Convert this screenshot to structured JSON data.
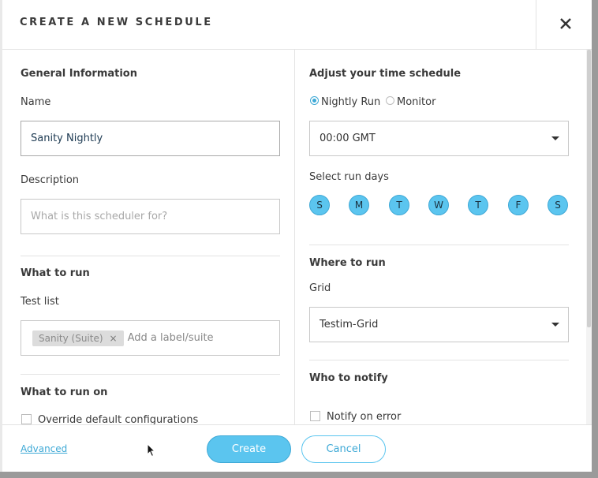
{
  "modal": {
    "title": "CREATE A NEW SCHEDULE"
  },
  "left": {
    "general_heading": "General Information",
    "name_label": "Name",
    "name_value": "Sanity Nightly",
    "description_label": "Description",
    "description_placeholder": "What is this scheduler for?",
    "what_to_run_heading": "What to run",
    "test_list_label": "Test list",
    "test_list_tags": [
      {
        "label": "Sanity (Suite)",
        "remove": "×"
      }
    ],
    "test_list_placeholder": "Add a label/suite",
    "what_to_run_on_heading": "What to run on",
    "override_label": "Override default configurations"
  },
  "right": {
    "time_heading": "Adjust your time schedule",
    "modes": [
      {
        "label": "Nightly Run",
        "checked": true
      },
      {
        "label": "Monitor",
        "checked": false
      }
    ],
    "time_value": "00:00 GMT",
    "run_days_label": "Select run days",
    "days": [
      "S",
      "M",
      "T",
      "W",
      "T",
      "F",
      "S"
    ],
    "where_heading": "Where to run",
    "grid_label": "Grid",
    "grid_value": "Testim-Grid",
    "notify_heading": "Who to notify",
    "notify_on_error_label": "Notify on error"
  },
  "footer": {
    "advanced_label": "Advanced",
    "create_label": "Create",
    "cancel_label": "Cancel"
  },
  "colors": {
    "accent": "#5bc5ef",
    "accent_dark": "#3ea9d6",
    "border": "#c8c8c8",
    "text": "#333333"
  }
}
